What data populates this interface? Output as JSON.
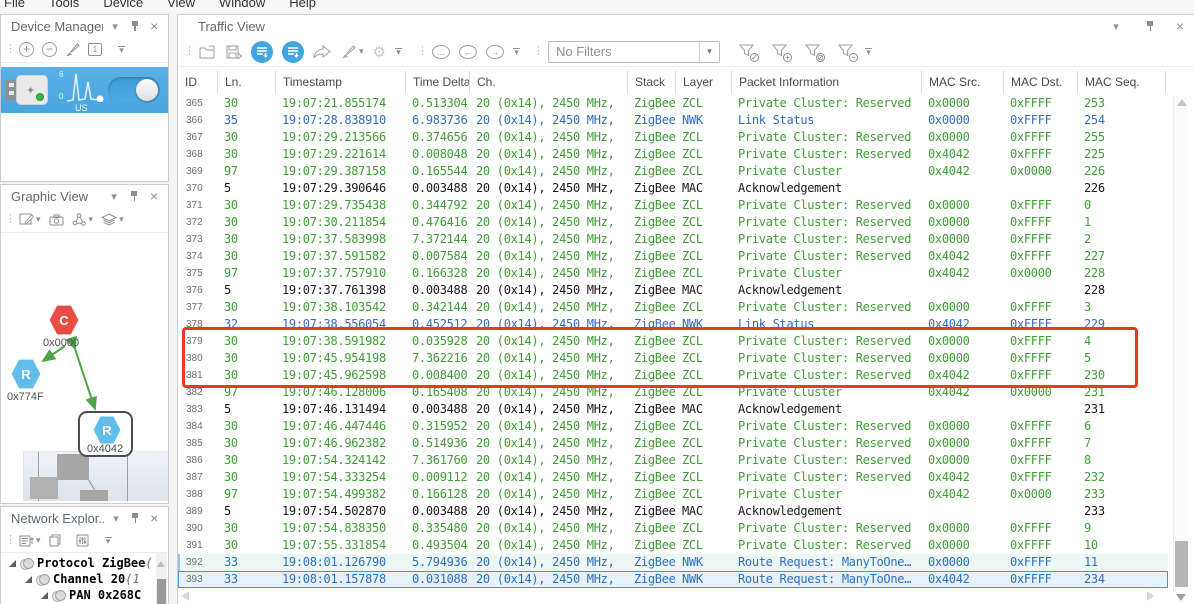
{
  "menu": {
    "items": [
      "File",
      "Tools",
      "Device",
      "View",
      "Window",
      "Help"
    ]
  },
  "device_manager": {
    "title": "Device Manager",
    "toolbar": {
      "add": "+",
      "remove": "−",
      "calendar_label": "1"
    },
    "card": {
      "spark_max": "6",
      "spark_min": "0",
      "device_label": "US",
      "toggle_state": "on",
      "status_color": "#39b54a",
      "card_color": "#4fa9e2"
    }
  },
  "graphic_view": {
    "title": "Graphic View",
    "nodes": [
      {
        "type": "C",
        "label": "0x0000",
        "role": "coordinator",
        "color": "#e84c42"
      },
      {
        "type": "R",
        "label": "0x774F",
        "role": "router",
        "color": "#62bdeb"
      },
      {
        "type": "R",
        "label": "0x4042",
        "role": "router",
        "color": "#62bdeb",
        "selected": true
      }
    ],
    "link_color": "#4ea447"
  },
  "network_explorer": {
    "title": "Network Explor...",
    "tree": [
      {
        "label": "Protocol ZigBee",
        "suffix": " (",
        "level": 0
      },
      {
        "label": "Channel 20",
        "suffix": " (1",
        "level": 1
      },
      {
        "label": "PAN 0x268C",
        "suffix": "",
        "level": 2
      }
    ]
  },
  "traffic": {
    "title": "Traffic View",
    "filter_value": "No Filters",
    "columns": [
      "ID",
      "Ln.",
      "Timestamp",
      "Time Delta",
      "Ch.",
      "Stack",
      "Layer",
      "Packet Information",
      "MAC Src.",
      "MAC Dst.",
      "MAC Seq."
    ],
    "layer_colors": {
      "zcl": "#3f9e35",
      "nwk": "#2e6fc0",
      "mac": "#1b1b1b"
    },
    "annotation_color": "#e63a22",
    "rows": [
      {
        "id": "365",
        "ln": "30",
        "timestamp": "19:07:21.855174",
        "delta": "0.513304",
        "ch": "20 (0x14), 2450 MHz,",
        "stack": "ZigBee",
        "layer": "ZCL",
        "info": "Private Cluster: Reserved",
        "src": "0x0000",
        "dst": "0xFFFF",
        "seq": "253",
        "color": "zcl",
        "state": ""
      },
      {
        "id": "366",
        "ln": "35",
        "timestamp": "19:07:28.838910",
        "delta": "6.983736",
        "ch": "20 (0x14), 2450 MHz,",
        "stack": "ZigBee",
        "layer": "NWK",
        "info": "Link Status",
        "src": "0x0000",
        "dst": "0xFFFF",
        "seq": "254",
        "color": "nwk",
        "state": ""
      },
      {
        "id": "367",
        "ln": "30",
        "timestamp": "19:07:29.213566",
        "delta": "0.374656",
        "ch": "20 (0x14), 2450 MHz,",
        "stack": "ZigBee",
        "layer": "ZCL",
        "info": "Private Cluster: Reserved",
        "src": "0x0000",
        "dst": "0xFFFF",
        "seq": "255",
        "color": "zcl",
        "state": ""
      },
      {
        "id": "368",
        "ln": "30",
        "timestamp": "19:07:29.221614",
        "delta": "0.008048",
        "ch": "20 (0x14), 2450 MHz,",
        "stack": "ZigBee",
        "layer": "ZCL",
        "info": "Private Cluster: Reserved",
        "src": "0x4042",
        "dst": "0xFFFF",
        "seq": "225",
        "color": "zcl",
        "state": ""
      },
      {
        "id": "369",
        "ln": "97",
        "timestamp": "19:07:29.387158",
        "delta": "0.165544",
        "ch": "20 (0x14), 2450 MHz,",
        "stack": "ZigBee",
        "layer": "ZCL",
        "info": "Private Cluster",
        "src": "0x4042",
        "dst": "0x0000",
        "seq": "226",
        "color": "zcl",
        "state": ""
      },
      {
        "id": "370",
        "ln": "5",
        "timestamp": "19:07:29.390646",
        "delta": "0.003488",
        "ch": "20 (0x14), 2450 MHz,",
        "stack": "ZigBee",
        "layer": "MAC",
        "info": "Acknowledgement",
        "src": "",
        "dst": "",
        "seq": "226",
        "color": "mac",
        "state": ""
      },
      {
        "id": "371",
        "ln": "30",
        "timestamp": "19:07:29.735438",
        "delta": "0.344792",
        "ch": "20 (0x14), 2450 MHz,",
        "stack": "ZigBee",
        "layer": "ZCL",
        "info": "Private Cluster: Reserved",
        "src": "0x0000",
        "dst": "0xFFFF",
        "seq": "0",
        "color": "zcl",
        "state": ""
      },
      {
        "id": "372",
        "ln": "30",
        "timestamp": "19:07:30.211854",
        "delta": "0.476416",
        "ch": "20 (0x14), 2450 MHz,",
        "stack": "ZigBee",
        "layer": "ZCL",
        "info": "Private Cluster: Reserved",
        "src": "0x0000",
        "dst": "0xFFFF",
        "seq": "1",
        "color": "zcl",
        "state": ""
      },
      {
        "id": "373",
        "ln": "30",
        "timestamp": "19:07:37.583998",
        "delta": "7.372144",
        "ch": "20 (0x14), 2450 MHz,",
        "stack": "ZigBee",
        "layer": "ZCL",
        "info": "Private Cluster: Reserved",
        "src": "0x0000",
        "dst": "0xFFFF",
        "seq": "2",
        "color": "zcl",
        "state": ""
      },
      {
        "id": "374",
        "ln": "30",
        "timestamp": "19:07:37.591582",
        "delta": "0.007584",
        "ch": "20 (0x14), 2450 MHz,",
        "stack": "ZigBee",
        "layer": "ZCL",
        "info": "Private Cluster: Reserved",
        "src": "0x4042",
        "dst": "0xFFFF",
        "seq": "227",
        "color": "zcl",
        "state": ""
      },
      {
        "id": "375",
        "ln": "97",
        "timestamp": "19:07:37.757910",
        "delta": "0.166328",
        "ch": "20 (0x14), 2450 MHz,",
        "stack": "ZigBee",
        "layer": "ZCL",
        "info": "Private Cluster",
        "src": "0x4042",
        "dst": "0x0000",
        "seq": "228",
        "color": "zcl",
        "state": ""
      },
      {
        "id": "376",
        "ln": "5",
        "timestamp": "19:07:37.761398",
        "delta": "0.003488",
        "ch": "20 (0x14), 2450 MHz,",
        "stack": "ZigBee",
        "layer": "MAC",
        "info": "Acknowledgement",
        "src": "",
        "dst": "",
        "seq": "228",
        "color": "mac",
        "state": ""
      },
      {
        "id": "377",
        "ln": "30",
        "timestamp": "19:07:38.103542",
        "delta": "0.342144",
        "ch": "20 (0x14), 2450 MHz,",
        "stack": "ZigBee",
        "layer": "ZCL",
        "info": "Private Cluster: Reserved",
        "src": "0x0000",
        "dst": "0xFFFF",
        "seq": "3",
        "color": "zcl",
        "state": ""
      },
      {
        "id": "378",
        "ln": "32",
        "timestamp": "19:07:38.556054",
        "delta": "0.452512",
        "ch": "20 (0x14), 2450 MHz,",
        "stack": "ZigBee",
        "layer": "NWK",
        "info": "Link Status",
        "src": "0x4042",
        "dst": "0xFFFF",
        "seq": "229",
        "color": "nwk",
        "state": ""
      },
      {
        "id": "379",
        "ln": "30",
        "timestamp": "19:07:38.591982",
        "delta": "0.035928",
        "ch": "20 (0x14), 2450 MHz,",
        "stack": "ZigBee",
        "layer": "ZCL",
        "info": "Private Cluster: Reserved",
        "src": "0x0000",
        "dst": "0xFFFF",
        "seq": "4",
        "color": "zcl",
        "state": ""
      },
      {
        "id": "380",
        "ln": "30",
        "timestamp": "19:07:45.954198",
        "delta": "7.362216",
        "ch": "20 (0x14), 2450 MHz,",
        "stack": "ZigBee",
        "layer": "ZCL",
        "info": "Private Cluster: Reserved",
        "src": "0x0000",
        "dst": "0xFFFF",
        "seq": "5",
        "color": "zcl",
        "state": ""
      },
      {
        "id": "381",
        "ln": "30",
        "timestamp": "19:07:45.962598",
        "delta": "0.008400",
        "ch": "20 (0x14), 2450 MHz,",
        "stack": "ZigBee",
        "layer": "ZCL",
        "info": "Private Cluster: Reserved",
        "src": "0x4042",
        "dst": "0xFFFF",
        "seq": "230",
        "color": "zcl",
        "state": ""
      },
      {
        "id": "382",
        "ln": "97",
        "timestamp": "19:07:46.128006",
        "delta": "0.165408",
        "ch": "20 (0x14), 2450 MHz,",
        "stack": "ZigBee",
        "layer": "ZCL",
        "info": "Private Cluster",
        "src": "0x4042",
        "dst": "0x0000",
        "seq": "231",
        "color": "zcl",
        "state": ""
      },
      {
        "id": "383",
        "ln": "5",
        "timestamp": "19:07:46.131494",
        "delta": "0.003488",
        "ch": "20 (0x14), 2450 MHz,",
        "stack": "ZigBee",
        "layer": "MAC",
        "info": "Acknowledgement",
        "src": "",
        "dst": "",
        "seq": "231",
        "color": "mac",
        "state": ""
      },
      {
        "id": "384",
        "ln": "30",
        "timestamp": "19:07:46.447446",
        "delta": "0.315952",
        "ch": "20 (0x14), 2450 MHz,",
        "stack": "ZigBee",
        "layer": "ZCL",
        "info": "Private Cluster: Reserved",
        "src": "0x0000",
        "dst": "0xFFFF",
        "seq": "6",
        "color": "zcl",
        "state": ""
      },
      {
        "id": "385",
        "ln": "30",
        "timestamp": "19:07:46.962382",
        "delta": "0.514936",
        "ch": "20 (0x14), 2450 MHz,",
        "stack": "ZigBee",
        "layer": "ZCL",
        "info": "Private Cluster: Reserved",
        "src": "0x0000",
        "dst": "0xFFFF",
        "seq": "7",
        "color": "zcl",
        "state": ""
      },
      {
        "id": "386",
        "ln": "30",
        "timestamp": "19:07:54.324142",
        "delta": "7.361760",
        "ch": "20 (0x14), 2450 MHz,",
        "stack": "ZigBee",
        "layer": "ZCL",
        "info": "Private Cluster: Reserved",
        "src": "0x0000",
        "dst": "0xFFFF",
        "seq": "8",
        "color": "zcl",
        "state": ""
      },
      {
        "id": "387",
        "ln": "30",
        "timestamp": "19:07:54.333254",
        "delta": "0.009112",
        "ch": "20 (0x14), 2450 MHz,",
        "stack": "ZigBee",
        "layer": "ZCL",
        "info": "Private Cluster: Reserved",
        "src": "0x4042",
        "dst": "0xFFFF",
        "seq": "232",
        "color": "zcl",
        "state": ""
      },
      {
        "id": "388",
        "ln": "97",
        "timestamp": "19:07:54.499382",
        "delta": "0.166128",
        "ch": "20 (0x14), 2450 MHz,",
        "stack": "ZigBee",
        "layer": "ZCL",
        "info": "Private Cluster",
        "src": "0x4042",
        "dst": "0x0000",
        "seq": "233",
        "color": "zcl",
        "state": ""
      },
      {
        "id": "389",
        "ln": "5",
        "timestamp": "19:07:54.502870",
        "delta": "0.003488",
        "ch": "20 (0x14), 2450 MHz,",
        "stack": "ZigBee",
        "layer": "MAC",
        "info": "Acknowledgement",
        "src": "",
        "dst": "",
        "seq": "233",
        "color": "mac",
        "state": ""
      },
      {
        "id": "390",
        "ln": "30",
        "timestamp": "19:07:54.838350",
        "delta": "0.335480",
        "ch": "20 (0x14), 2450 MHz,",
        "stack": "ZigBee",
        "layer": "ZCL",
        "info": "Private Cluster: Reserved",
        "src": "0x0000",
        "dst": "0xFFFF",
        "seq": "9",
        "color": "zcl",
        "state": ""
      },
      {
        "id": "391",
        "ln": "30",
        "timestamp": "19:07:55.331854",
        "delta": "0.493504",
        "ch": "20 (0x14), 2450 MHz,",
        "stack": "ZigBee",
        "layer": "ZCL",
        "info": "Private Cluster: Reserved",
        "src": "0x0000",
        "dst": "0xFFFF",
        "seq": "10",
        "color": "zcl",
        "state": ""
      },
      {
        "id": "392",
        "ln": "33",
        "timestamp": "19:08:01.126790",
        "delta": "5.794936",
        "ch": "20 (0x14), 2450 MHz,",
        "stack": "ZigBee",
        "layer": "NWK",
        "info": "Route Request: ManyToOne…",
        "src": "0x0000",
        "dst": "0xFFFF",
        "seq": "11",
        "color": "nwk",
        "state": "hl-soft"
      },
      {
        "id": "393",
        "ln": "33",
        "timestamp": "19:08:01.157878",
        "delta": "0.031088",
        "ch": "20 (0x14), 2450 MHz,",
        "stack": "ZigBee",
        "layer": "NWK",
        "info": "Route Request: ManyToOne…",
        "src": "0x4042",
        "dst": "0xFFFF",
        "seq": "234",
        "color": "nwk",
        "state": "hl-selected"
      }
    ]
  },
  "icons": {
    "bubble_more": "…",
    "bubble_prev": "←",
    "bubble_next": "→",
    "funnel_badges": [
      "✓",
      "+",
      "⊘",
      "−"
    ],
    "gear": "⚙",
    "close": "×",
    "dropdown": "▾"
  }
}
